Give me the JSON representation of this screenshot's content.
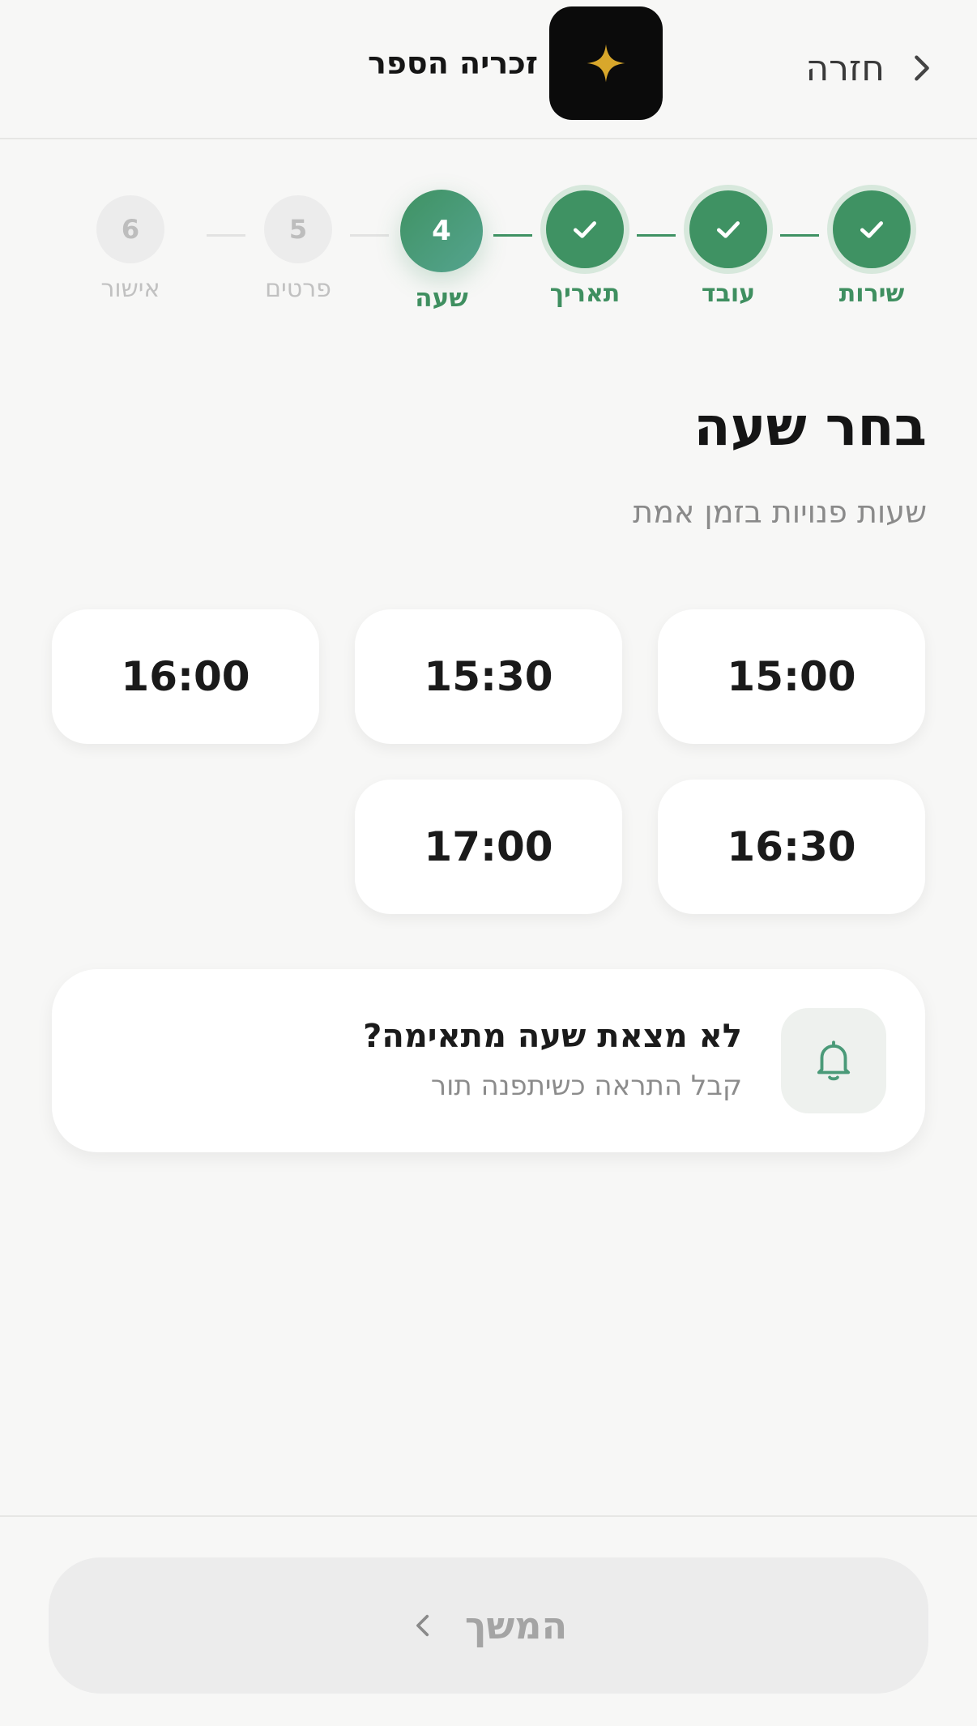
{
  "header": {
    "back_label": "חזרה",
    "brand_name": "זכריה הספר",
    "logo_icon": "sparkle-icon",
    "logo_color": "#d8a72b"
  },
  "stepper": {
    "steps": [
      {
        "number": "1",
        "label": "שירות",
        "state": "done"
      },
      {
        "number": "2",
        "label": "עובד",
        "state": "done"
      },
      {
        "number": "3",
        "label": "תאריך",
        "state": "done"
      },
      {
        "number": "4",
        "label": "שעה",
        "state": "current"
      },
      {
        "number": "5",
        "label": "פרטים",
        "state": "pending"
      },
      {
        "number": "6",
        "label": "אישור",
        "state": "pending"
      }
    ],
    "accent": "#3f9263"
  },
  "main": {
    "title": "בחר שעה",
    "subtitle": "שעות פנויות בזמן אמת",
    "time_slots": [
      "15:00",
      "15:30",
      "16:00",
      "16:30",
      "17:00"
    ]
  },
  "notify": {
    "title": "לא מצאת שעה מתאימה?",
    "subtitle": "קבל התראה כשיתפנה תור",
    "icon": "bell-icon"
  },
  "footer": {
    "continue_label": "המשך"
  }
}
